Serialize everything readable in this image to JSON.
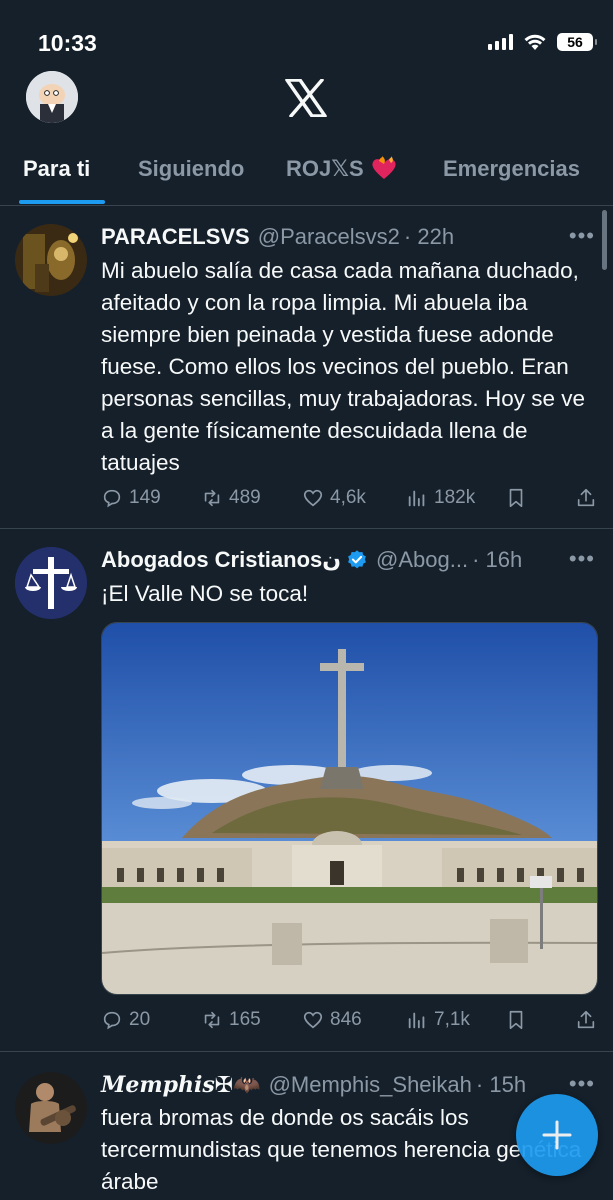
{
  "status_bar": {
    "time": "10:33",
    "battery": "56"
  },
  "top_bar": {
    "avatar": "profile-avatar",
    "logo": "x-logo-icon"
  },
  "tabs": [
    {
      "label": "Para ti",
      "active": true
    },
    {
      "label": "Siguiendo",
      "active": false
    },
    {
      "label": "ROJ𝕏S",
      "active": false,
      "emoji": "heart-on-fire"
    },
    {
      "label": "Emergencias",
      "active": false
    }
  ],
  "tweets": [
    {
      "name": "PARACELSVS",
      "handle": "@Paracelsvs2",
      "time": "· 22h",
      "text": "Mi abuelo salía de casa cada mañana duchado, afeitado y con la ropa limpia. Mi abuela iba siempre bien peinada y vestida fuese adonde fuese. Como ellos los vecinos del pueblo. Eran personas sencillas, muy trabajadoras. Hoy se ve a la gente físicamente descuidada llena de tatuajes",
      "replies": "149",
      "reposts": "489",
      "likes": "4,6k",
      "views": "182k"
    },
    {
      "name": "Abogados Cristianos",
      "name_suffix": "ن",
      "verified": true,
      "handle": "@Abog...",
      "time": "· 16h",
      "text": "¡El Valle NO se toca!",
      "media": "valle-de-los-caidos-photo",
      "replies": "20",
      "reposts": "165",
      "likes": "846",
      "views": "7,1k"
    },
    {
      "name": "𝑴𝒆𝒎𝒑𝒉𝒊𝒔",
      "name_suffix": "✠🦇",
      "handle": "@Memphis_Sheikah",
      "time": "· 15h",
      "text": "fuera bromas de donde os sacáis los tercermundistas que tenemos herencia genética árabe"
    }
  ],
  "colors": {
    "background": "#15202b",
    "accent": "#1d9bf0",
    "muted": "#8b98a5",
    "divider": "#38444d"
  }
}
